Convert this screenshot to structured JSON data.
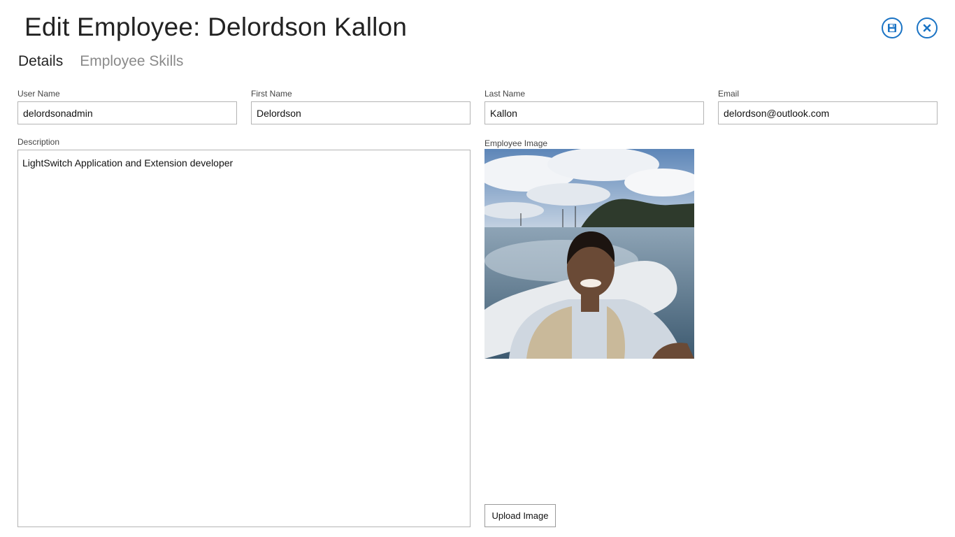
{
  "header": {
    "title": "Edit Employee: Delordson Kallon",
    "save_icon": "floppy-disk-icon",
    "close_icon": "close-icon",
    "accent_color": "#1a73c4"
  },
  "tabs": [
    {
      "label": "Details",
      "active": true
    },
    {
      "label": "Employee Skills",
      "active": false
    }
  ],
  "form": {
    "user_name": {
      "label": "User Name",
      "value": "delordsonadmin"
    },
    "first_name": {
      "label": "First Name",
      "value": "Delordson"
    },
    "last_name": {
      "label": "Last Name",
      "value": "Kallon"
    },
    "email": {
      "label": "Email",
      "value": "delordson@outlook.com"
    },
    "description": {
      "label": "Description",
      "value": "LightSwitch Application and Extension developer"
    },
    "employee_image": {
      "label": "Employee Image"
    }
  },
  "upload_button": {
    "label": "Upload Image"
  }
}
